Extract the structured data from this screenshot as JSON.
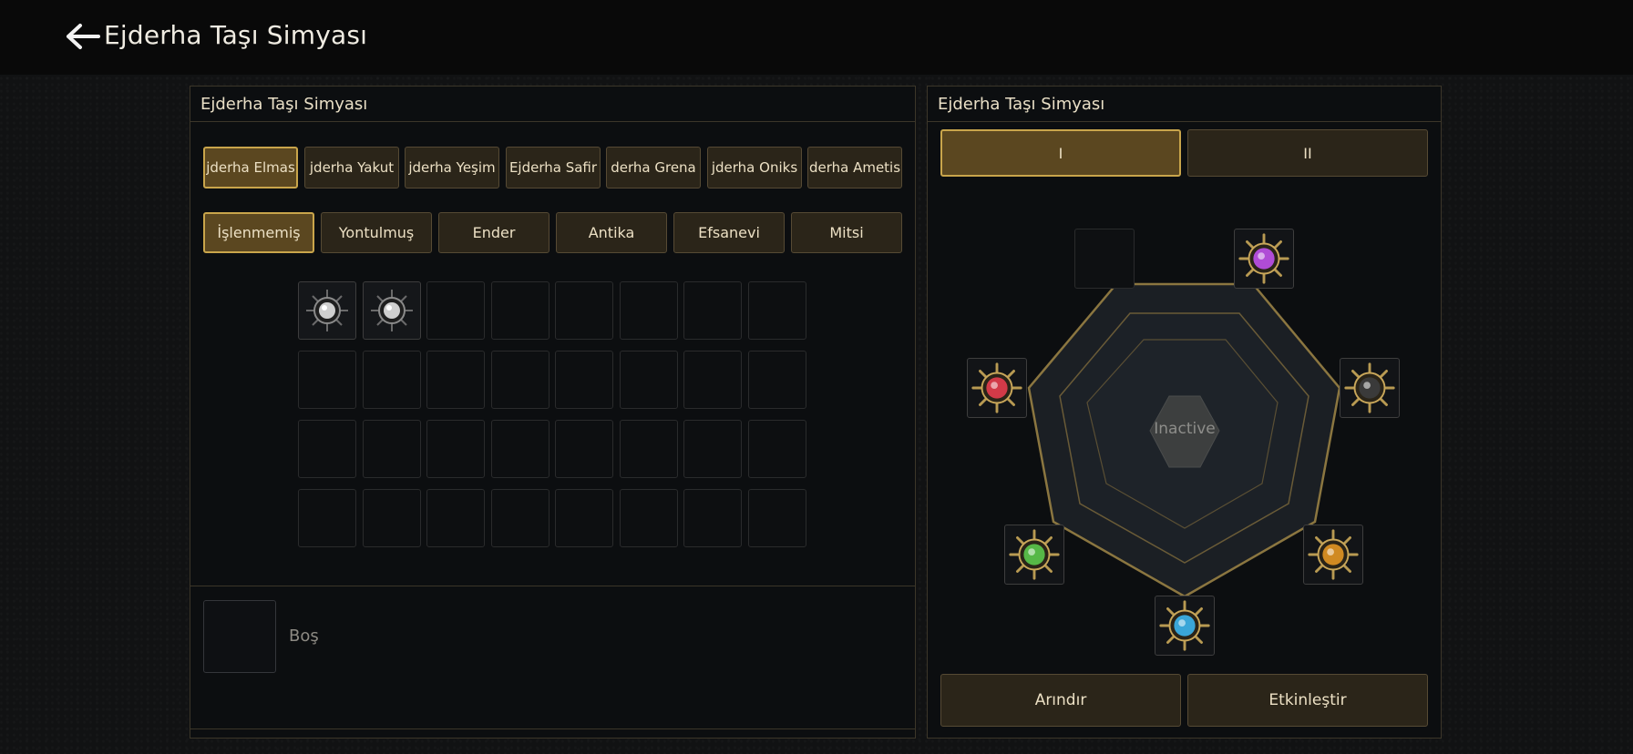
{
  "header": {
    "title": "Ejderha Taşı Simyası"
  },
  "left_panel": {
    "title": "Ejderha Taşı Simyası",
    "stone_tabs": [
      "jderha Elmas",
      "jderha Yakut",
      "jderha Yeşim",
      "Ejderha Safir",
      "derha Grena",
      "jderha Oniks",
      "derha Ametis"
    ],
    "active_stone": 0,
    "grade_tabs": [
      "İşlenmemiş",
      "Yontulmuş",
      "Ender",
      "Antika",
      "Efsanevi",
      "Mitsi"
    ],
    "active_grade": 0,
    "inventory": {
      "rows": 4,
      "cols": 8,
      "filled": 2,
      "item_icon": "white-dragon-stone-icon"
    },
    "detail": {
      "label": "Boş"
    }
  },
  "right_panel": {
    "title": "Ejderha Taşı Simyası",
    "page_tabs": [
      "I",
      "II"
    ],
    "active_page": 0,
    "core_status": "Inactive",
    "sockets": [
      {
        "name": "top-left-socket",
        "state": "empty",
        "color": ""
      },
      {
        "name": "purple-stone-socket",
        "state": "filled",
        "color": "#b04cd6"
      },
      {
        "name": "black-stone-socket",
        "state": "filled",
        "color": "#3a3a3a"
      },
      {
        "name": "amber-stone-socket",
        "state": "filled",
        "color": "#d08a22"
      },
      {
        "name": "blue-stone-socket",
        "state": "filled",
        "color": "#3aa6d8"
      },
      {
        "name": "green-stone-socket",
        "state": "filled",
        "color": "#56b847"
      },
      {
        "name": "red-stone-socket",
        "state": "filled",
        "color": "#d23a48"
      }
    ],
    "buttons": {
      "refine": "Arındır",
      "activate": "Etkinleştir"
    }
  },
  "colors": {
    "accent": "#c9a54b",
    "tab_bg": "#2b2519",
    "active_tab_bg": "#5b4720",
    "hex_line": "#8b7640"
  }
}
